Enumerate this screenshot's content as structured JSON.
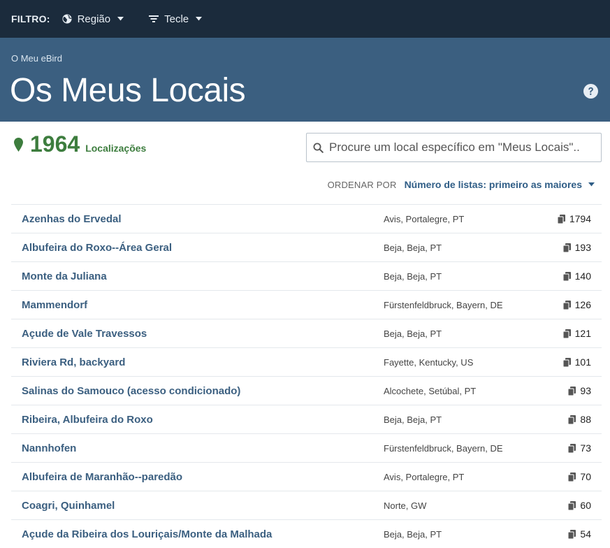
{
  "filter": {
    "label": "FILTRO:",
    "region_label": "Região",
    "key_label": "Tecle"
  },
  "header": {
    "breadcrumb": "O Meu eBird",
    "title": "Os Meus Locais"
  },
  "summary": {
    "count": "1964",
    "count_label": "Localizações"
  },
  "search": {
    "placeholder": "Procure um local específico em \"Meus Locais\".."
  },
  "sort": {
    "label": "ORDENAR POR",
    "value": "Número de listas: primeiro as maiores"
  },
  "locations": [
    {
      "name": "Azenhas do Ervedal",
      "region": "Avis, Portalegre, PT",
      "count": "1794"
    },
    {
      "name": "Albufeira do Roxo--Área Geral",
      "region": "Beja, Beja, PT",
      "count": "193"
    },
    {
      "name": "Monte da Juliana",
      "region": "Beja, Beja, PT",
      "count": "140"
    },
    {
      "name": "Mammendorf",
      "region": "Fürstenfeldbruck, Bayern, DE",
      "count": "126"
    },
    {
      "name": "Açude de Vale Travessos",
      "region": "Beja, Beja, PT",
      "count": "121"
    },
    {
      "name": "Riviera Rd, backyard",
      "region": "Fayette, Kentucky, US",
      "count": "101"
    },
    {
      "name": "Salinas do Samouco (acesso condicionado)",
      "region": "Alcochete, Setúbal, PT",
      "count": "93"
    },
    {
      "name": "Ribeira, Albufeira do Roxo",
      "region": "Beja, Beja, PT",
      "count": "88"
    },
    {
      "name": "Nannhofen",
      "region": "Fürstenfeldbruck, Bayern, DE",
      "count": "73"
    },
    {
      "name": "Albufeira de Maranhão--paredão",
      "region": "Avis, Portalegre, PT",
      "count": "70"
    },
    {
      "name": "Coagri, Quinhamel",
      "region": "Norte, GW",
      "count": "60"
    },
    {
      "name": "Açude da Ribeira dos Louriçais/Monte da Malhada",
      "region": "Beja, Beja, PT",
      "count": "54"
    }
  ],
  "colors": {
    "filterbar": "#1b2b3c",
    "header": "#3b5f80",
    "accent_green": "#3d7d3e",
    "link_blue": "#3b5f80"
  }
}
